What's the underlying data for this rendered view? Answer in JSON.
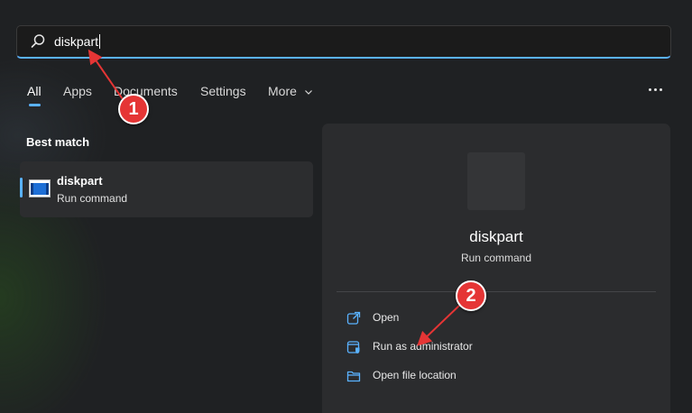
{
  "search": {
    "value": "diskpart"
  },
  "tabs": [
    {
      "label": "All",
      "active": true
    },
    {
      "label": "Apps"
    },
    {
      "label": "Documents"
    },
    {
      "label": "Settings"
    },
    {
      "label": "More"
    }
  ],
  "best_match": {
    "heading": "Best match",
    "item": {
      "title": "diskpart",
      "subtitle": "Run command"
    }
  },
  "detail": {
    "title": "diskpart",
    "subtitle": "Run command",
    "actions": [
      {
        "label": "Open",
        "icon": "open-external-icon"
      },
      {
        "label": "Run as administrator",
        "icon": "shield-admin-icon"
      },
      {
        "label": "Open file location",
        "icon": "folder-icon"
      }
    ]
  },
  "annotations": [
    {
      "number": "1"
    },
    {
      "number": "2"
    }
  ],
  "colors": {
    "accent": "#5ab2ff",
    "annotation": "#e53535",
    "background": "#1f2123",
    "panel": "#2b2c2e"
  }
}
